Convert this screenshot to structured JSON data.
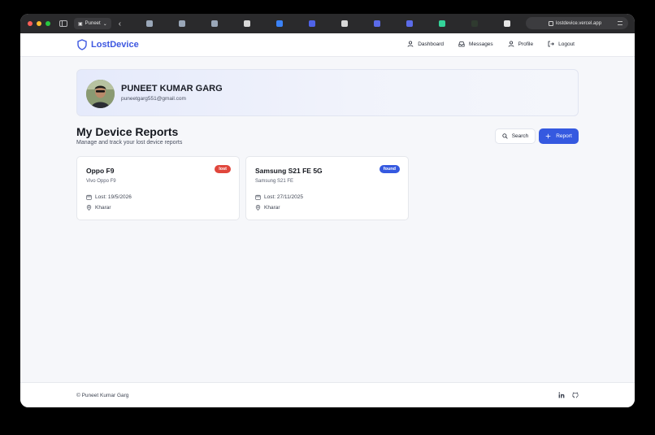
{
  "browser": {
    "profile_label": "Puneet",
    "url": "lostdevice.vercel.app",
    "tab_colors": [
      "#9aa7b8",
      "#9aa7b8",
      "#9aa7b8",
      "#d8d8d8",
      "#3b82f6",
      "#4f63e8",
      "#d8d8d8",
      "#5b6be8",
      "#5b6be8",
      "#34d399",
      "#2f3a2f",
      "#e5e5e5"
    ]
  },
  "header": {
    "brand": "LostDevice",
    "nav": [
      {
        "label": "Dashboard",
        "icon": "user-icon"
      },
      {
        "label": "Messages",
        "icon": "inbox-icon"
      },
      {
        "label": "Profile",
        "icon": "user-icon"
      },
      {
        "label": "Logout",
        "icon": "logout-icon"
      }
    ]
  },
  "profile": {
    "name": "PUNEET KUMAR GARG",
    "email": "puneetgarg551@gmail.com"
  },
  "section": {
    "title": "My Device Reports",
    "subtitle": "Manage and track your lost device reports",
    "search_label": "Search",
    "report_label": "Report"
  },
  "devices": [
    {
      "title": "Oppo F9",
      "subtitle": "Vivo Oppo F9",
      "status": "lost",
      "date": "Lost: 19/5/2026",
      "location": "Kharar"
    },
    {
      "title": "Samsung S21 FE 5G",
      "subtitle": "Samsung S21 FE",
      "status": "found",
      "date": "Lost: 27/11/2025",
      "location": "Kharar"
    }
  ],
  "footer": {
    "copyright": "© Puneet Kumar Garg"
  },
  "colors": {
    "accent": "#3559e0",
    "lost": "#e0463c",
    "found": "#3559e0"
  }
}
